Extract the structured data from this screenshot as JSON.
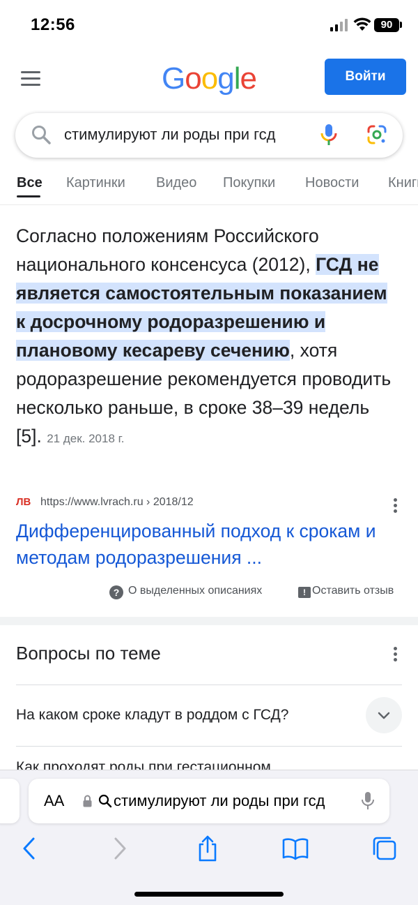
{
  "status_bar": {
    "time": "12:56",
    "battery": "90"
  },
  "header": {
    "logo_letters": [
      {
        "ch": "G",
        "color": "#4285F4"
      },
      {
        "ch": "o",
        "color": "#EA4335"
      },
      {
        "ch": "o",
        "color": "#FBBC05"
      },
      {
        "ch": "g",
        "color": "#4285F4"
      },
      {
        "ch": "l",
        "color": "#34A853"
      },
      {
        "ch": "e",
        "color": "#EA4335"
      }
    ],
    "signin_label": "Войти"
  },
  "search": {
    "query": "стимулируют ли роды при гсд"
  },
  "tabs": [
    {
      "label": "Все",
      "active": true
    },
    {
      "label": "Картинки"
    },
    {
      "label": "Видео"
    },
    {
      "label": "Покупки"
    },
    {
      "label": "Новости"
    },
    {
      "label": "Книги"
    }
  ],
  "snippet": {
    "text_before": "Согласно положениям Российского национального консенсуса (2012), ",
    "highlight": "ГСД не является самостоятельным показанием к досрочному родоразрешению и плановому кесареву сечению",
    "text_after": ", хотя родоразрешение рекомендуется проводить несколько раньше, в сроке 38–39 недель [5].",
    "date": "21 дек. 2018 г.",
    "source_badge": "ЛВ",
    "source_url": "https://www.lvrach.ru › 2018/12",
    "title": "Дифференцированный подход к срокам и методам родоразрешения ...",
    "about_label": "О выделенных описаниях",
    "feedback_label": "Оставить отзыв"
  },
  "related": {
    "title": "Вопросы по теме",
    "questions": [
      "На каком сроке кладут в роддом с ГСД?",
      "Как проходят роды при гестационном"
    ]
  },
  "browser": {
    "aa_label": "AA",
    "url_text": "стимулируют ли роды при гсд"
  },
  "colors": {
    "accent": "#1a73e8",
    "link": "#1558d6",
    "highlight": "#d3e3fd",
    "safari_blue": "#0a7aff"
  }
}
